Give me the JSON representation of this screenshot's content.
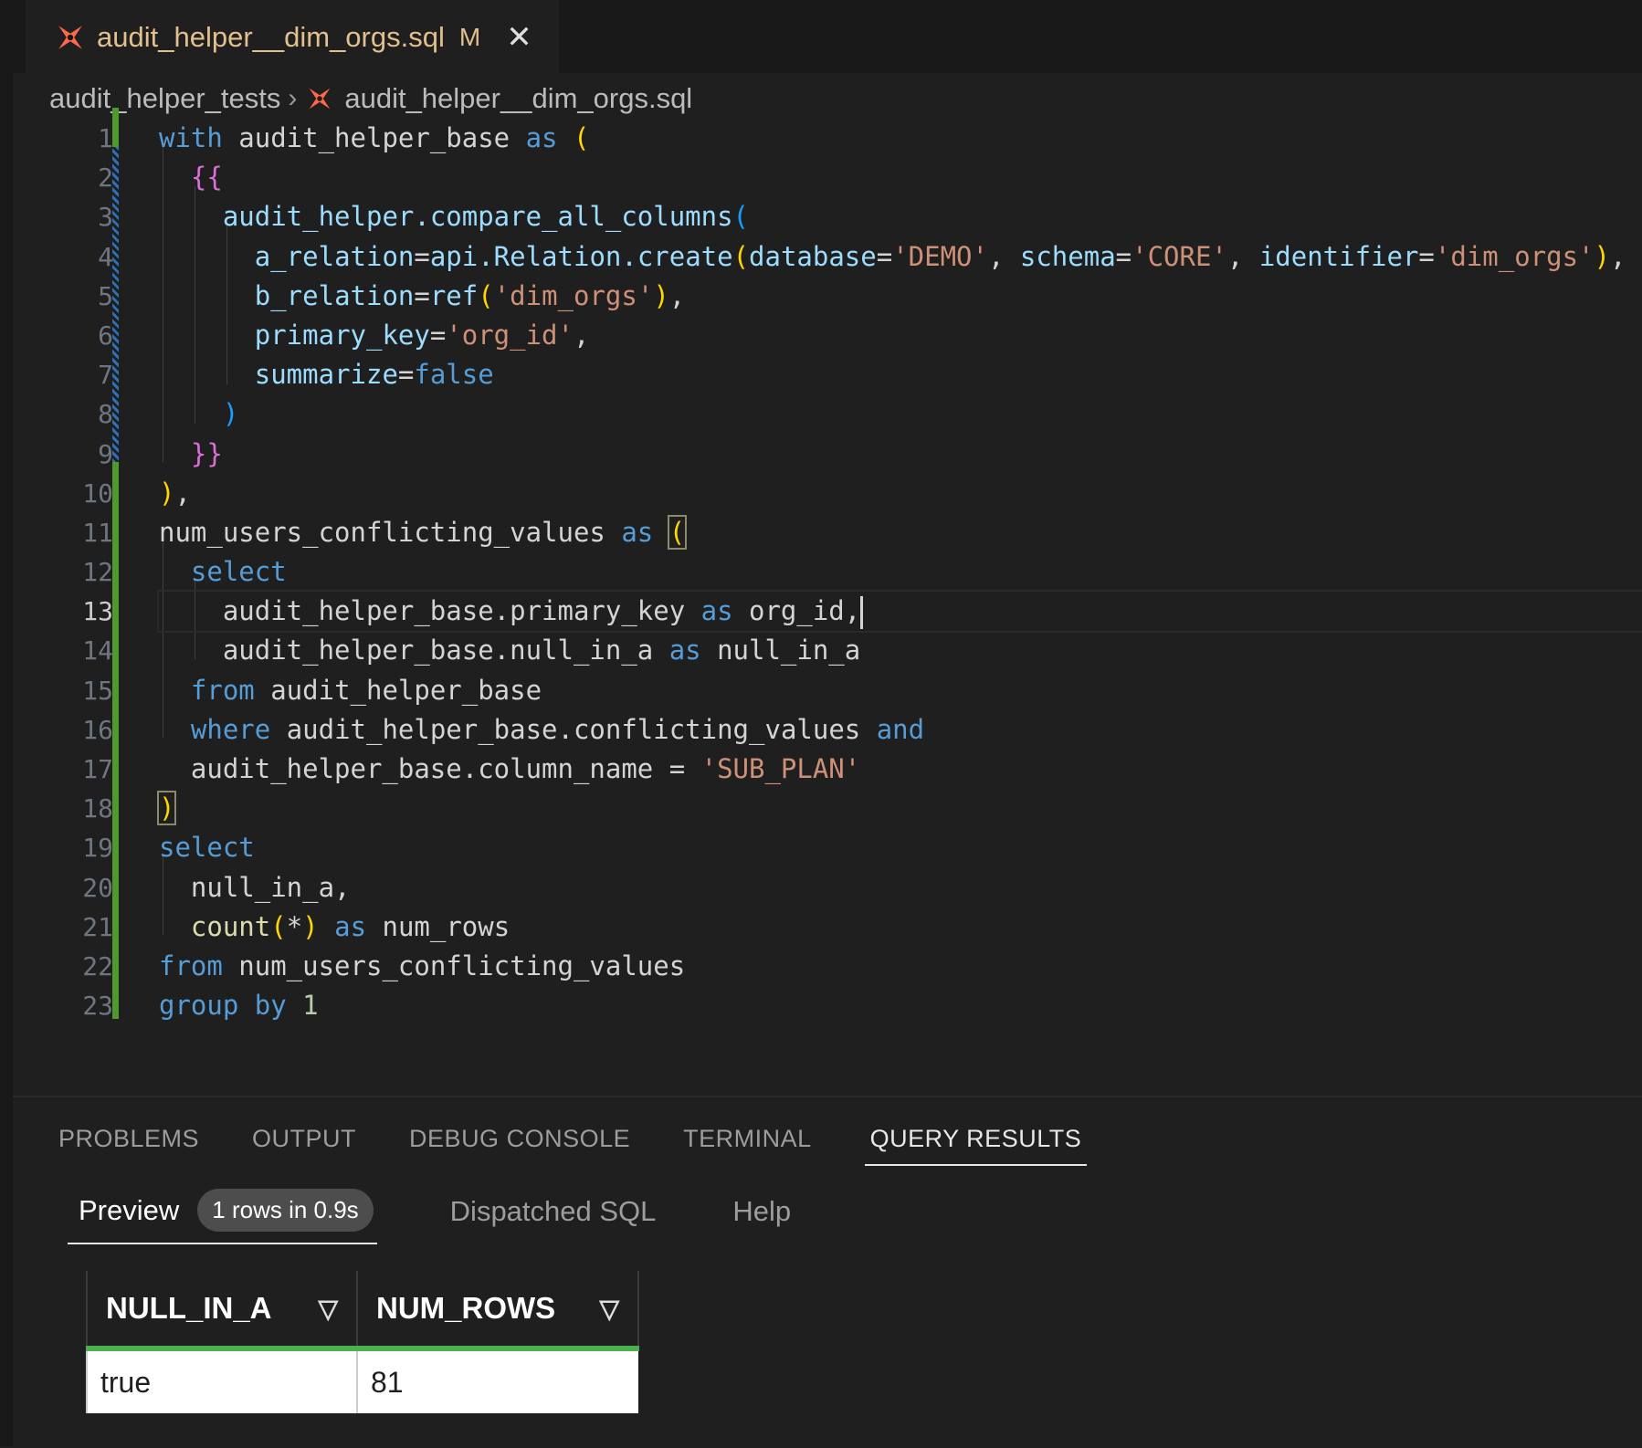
{
  "tab": {
    "title": "audit_helper__dim_orgs.sql",
    "modified": "M",
    "close": "✕"
  },
  "breadcrumb": {
    "folder": "audit_helper_tests",
    "separator": "›",
    "file": "audit_helper__dim_orgs.sql"
  },
  "editor": {
    "current_line": 13,
    "line_numbers": [
      "1",
      "2",
      "3",
      "4",
      "5",
      "6",
      "7",
      "8",
      "9",
      "10",
      "11",
      "12",
      "13",
      "14",
      "15",
      "16",
      "17",
      "18",
      "19",
      "20",
      "21",
      "22",
      "23"
    ],
    "lines": [
      [
        {
          "t": "with",
          "c": "kw"
        },
        {
          "t": " audit_helper_base ",
          "c": ""
        },
        {
          "t": "as",
          "c": "kw"
        },
        {
          "t": " ",
          "c": ""
        },
        {
          "t": "(",
          "c": "br1"
        }
      ],
      [
        {
          "t": "  ",
          "c": ""
        },
        {
          "t": "{{",
          "c": "brace"
        }
      ],
      [
        {
          "t": "    ",
          "c": ""
        },
        {
          "t": "audit_helper.compare_all_columns",
          "c": "var"
        },
        {
          "t": "(",
          "c": "br2"
        }
      ],
      [
        {
          "t": "      ",
          "c": ""
        },
        {
          "t": "a_relation",
          "c": "var"
        },
        {
          "t": "=",
          "c": ""
        },
        {
          "t": "api.Relation.create",
          "c": "var"
        },
        {
          "t": "(",
          "c": "br1"
        },
        {
          "t": "database",
          "c": "var"
        },
        {
          "t": "=",
          "c": ""
        },
        {
          "t": "'DEMO'",
          "c": "str"
        },
        {
          "t": ", ",
          "c": ""
        },
        {
          "t": "schema",
          "c": "var"
        },
        {
          "t": "=",
          "c": ""
        },
        {
          "t": "'CORE'",
          "c": "str"
        },
        {
          "t": ", ",
          "c": ""
        },
        {
          "t": "identifier",
          "c": "var"
        },
        {
          "t": "=",
          "c": ""
        },
        {
          "t": "'dim_orgs'",
          "c": "str"
        },
        {
          "t": ")",
          "c": "br1"
        },
        {
          "t": ",",
          "c": ""
        }
      ],
      [
        {
          "t": "      ",
          "c": ""
        },
        {
          "t": "b_relation",
          "c": "var"
        },
        {
          "t": "=",
          "c": ""
        },
        {
          "t": "ref",
          "c": "var"
        },
        {
          "t": "(",
          "c": "br1"
        },
        {
          "t": "'dim_orgs'",
          "c": "str"
        },
        {
          "t": ")",
          "c": "br1"
        },
        {
          "t": ",",
          "c": ""
        }
      ],
      [
        {
          "t": "      ",
          "c": ""
        },
        {
          "t": "primary_key",
          "c": "var"
        },
        {
          "t": "=",
          "c": ""
        },
        {
          "t": "'org_id'",
          "c": "str"
        },
        {
          "t": ",",
          "c": ""
        }
      ],
      [
        {
          "t": "      ",
          "c": ""
        },
        {
          "t": "summarize",
          "c": "var"
        },
        {
          "t": "=",
          "c": ""
        },
        {
          "t": "false",
          "c": "kw"
        }
      ],
      [
        {
          "t": "    ",
          "c": ""
        },
        {
          "t": ")",
          "c": "br2"
        }
      ],
      [
        {
          "t": "  ",
          "c": ""
        },
        {
          "t": "}}",
          "c": "brace"
        }
      ],
      [
        {
          "t": ")",
          "c": "br1"
        },
        {
          "t": ",",
          "c": ""
        }
      ],
      [
        {
          "t": "num_users_conflicting_values ",
          "c": ""
        },
        {
          "t": "as",
          "c": "kw"
        },
        {
          "t": " ",
          "c": ""
        },
        {
          "t": "(",
          "c": "br1 match"
        }
      ],
      [
        {
          "t": "  ",
          "c": ""
        },
        {
          "t": "select",
          "c": "kw"
        }
      ],
      [
        {
          "t": "    audit_helper_base.primary_key ",
          "c": ""
        },
        {
          "t": "as",
          "c": "kw"
        },
        {
          "t": " org_id,",
          "c": ""
        },
        {
          "t": "|",
          "c": "cursor"
        }
      ],
      [
        {
          "t": "    audit_helper_base.null_in_a ",
          "c": ""
        },
        {
          "t": "as",
          "c": "kw"
        },
        {
          "t": " null_in_a",
          "c": ""
        }
      ],
      [
        {
          "t": "  ",
          "c": ""
        },
        {
          "t": "from",
          "c": "kw"
        },
        {
          "t": " audit_helper_base",
          "c": ""
        }
      ],
      [
        {
          "t": "  ",
          "c": ""
        },
        {
          "t": "where",
          "c": "kw"
        },
        {
          "t": " audit_helper_base.conflicting_values ",
          "c": ""
        },
        {
          "t": "and",
          "c": "kw"
        }
      ],
      [
        {
          "t": "  audit_helper_base.column_name = ",
          "c": ""
        },
        {
          "t": "'SUB_PLAN'",
          "c": "str"
        }
      ],
      [
        {
          "t": ")",
          "c": "br1 match"
        }
      ],
      [
        {
          "t": "select",
          "c": "kw"
        }
      ],
      [
        {
          "t": "  null_in_a,",
          "c": ""
        }
      ],
      [
        {
          "t": "  ",
          "c": ""
        },
        {
          "t": "count",
          "c": "fn"
        },
        {
          "t": "(",
          "c": "br1"
        },
        {
          "t": "*",
          "c": ""
        },
        {
          "t": ")",
          "c": "br1"
        },
        {
          "t": " ",
          "c": ""
        },
        {
          "t": "as",
          "c": "kw"
        },
        {
          "t": " num_rows",
          "c": ""
        }
      ],
      [
        {
          "t": "from",
          "c": "kw"
        },
        {
          "t": " num_users_conflicting_values",
          "c": ""
        }
      ],
      [
        {
          "t": "group",
          "c": "kw"
        },
        {
          "t": " ",
          "c": ""
        },
        {
          "t": "by",
          "c": "kw"
        },
        {
          "t": " ",
          "c": ""
        },
        {
          "t": "1",
          "c": "num"
        }
      ]
    ]
  },
  "panel": {
    "tabs": [
      "PROBLEMS",
      "OUTPUT",
      "DEBUG CONSOLE",
      "TERMINAL",
      "QUERY RESULTS"
    ],
    "active_tab": "QUERY RESULTS",
    "subtabs": {
      "preview": "Preview",
      "badge": "1 rows in 0.9s",
      "dispatched": "Dispatched SQL",
      "help": "Help"
    },
    "results": {
      "columns": [
        "NULL_IN_A",
        "NUM_ROWS"
      ],
      "filter_icon": "▽",
      "rows": [
        [
          "true",
          "81"
        ]
      ]
    }
  },
  "colors": {
    "keyword": "#569cd6",
    "string": "#ce9178",
    "variable": "#9cdcfe",
    "modified_tab": "#e2c08d",
    "git_added": "#4e9a2f"
  }
}
